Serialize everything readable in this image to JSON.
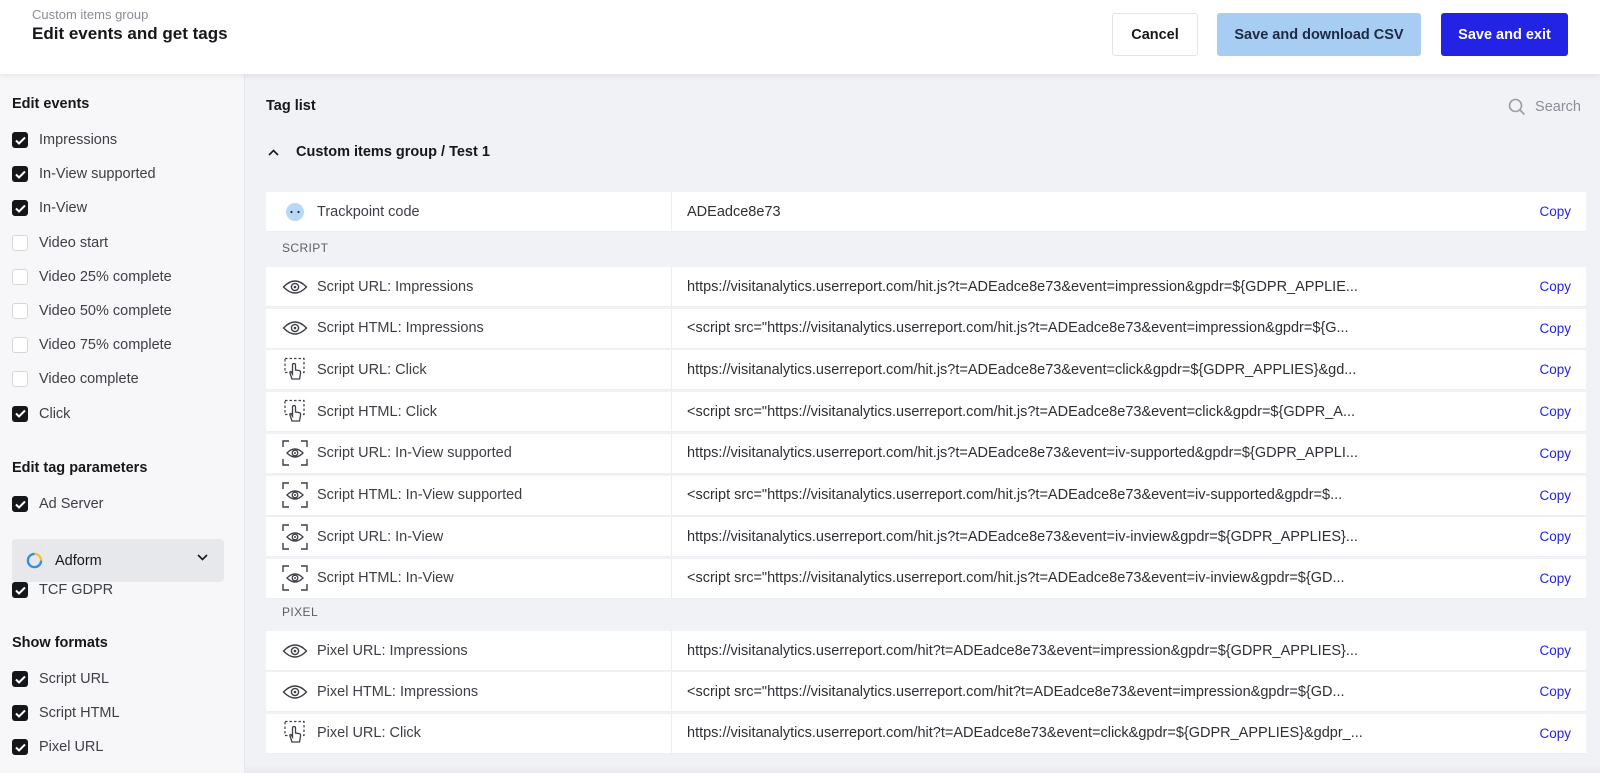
{
  "header": {
    "subtitle": "Custom items group",
    "title": "Edit events and get tags",
    "cancel_label": "Cancel",
    "csv_label": "Save and download CSV",
    "exit_label": "Save and exit"
  },
  "sidebar": {
    "edit_events_title": "Edit events",
    "events": [
      {
        "label": "Impressions",
        "checked": true
      },
      {
        "label": "In-View supported",
        "checked": true
      },
      {
        "label": "In-View",
        "checked": true
      },
      {
        "label": "Video start",
        "checked": false
      },
      {
        "label": "Video 25% complete",
        "checked": false
      },
      {
        "label": "Video 50% complete",
        "checked": false
      },
      {
        "label": "Video 75% complete",
        "checked": false
      },
      {
        "label": "Video complete",
        "checked": false
      },
      {
        "label": "Click",
        "checked": true
      }
    ],
    "tag_params_title": "Edit tag parameters",
    "ad_server_label": "Ad Server",
    "ad_server_checked": true,
    "ad_server_value": "Adform",
    "tcf_label": "TCF GDPR",
    "tcf_checked": true,
    "formats_title": "Show formats",
    "formats": [
      {
        "label": "Script URL",
        "checked": true
      },
      {
        "label": "Script HTML",
        "checked": true
      },
      {
        "label": "Pixel URL",
        "checked": true
      }
    ]
  },
  "main": {
    "tag_list_title": "Tag list",
    "search_placeholder": "Search",
    "group_title": "Custom items group / Test 1",
    "trackpoint": {
      "name": "Trackpoint code",
      "value": "ADEadce8e73",
      "copy": "Copy"
    },
    "script_label": "SCRIPT",
    "pixel_label": "PIXEL",
    "script_rows": [
      {
        "icon": "eye-icon",
        "name": "Script URL: Impressions",
        "value": "https://visitanalytics.userreport.com/hit.js?t=ADEadce8e73&event=impression&gpdr=${GDPR_APPLIE...",
        "copy": "Copy"
      },
      {
        "icon": "eye-icon",
        "name": "Script HTML: Impressions",
        "value": "<script src=\"https://visitanalytics.userreport.com/hit.js?t=ADEadce8e73&event=impression&gpdr=${G...",
        "copy": "Copy"
      },
      {
        "icon": "click-icon",
        "name": "Script URL: Click",
        "value": "https://visitanalytics.userreport.com/hit.js?t=ADEadce8e73&event=click&gpdr=${GDPR_APPLIES}&gd...",
        "copy": "Copy"
      },
      {
        "icon": "click-icon",
        "name": "Script HTML: Click",
        "value": "<script src=\"https://visitanalytics.userreport.com/hit.js?t=ADEadce8e73&event=click&gpdr=${GDPR_A...",
        "copy": "Copy"
      },
      {
        "icon": "inview-icon",
        "name": "Script URL: In-View supported",
        "value": "https://visitanalytics.userreport.com/hit.js?t=ADEadce8e73&event=iv-supported&gpdr=${GDPR_APPLI...",
        "copy": "Copy"
      },
      {
        "icon": "inview-icon",
        "name": "Script HTML: In-View supported",
        "value": "<script src=\"https://visitanalytics.userreport.com/hit.js?t=ADEadce8e73&event=iv-supported&gpdr=$...",
        "copy": "Copy"
      },
      {
        "icon": "inview-icon",
        "name": "Script URL: In-View",
        "value": "https://visitanalytics.userreport.com/hit.js?t=ADEadce8e73&event=iv-inview&gpdr=${GDPR_APPLIES}...",
        "copy": "Copy"
      },
      {
        "icon": "inview-icon",
        "name": "Script HTML: In-View",
        "value": "<script src=\"https://visitanalytics.userreport.com/hit.js?t=ADEadce8e73&event=iv-inview&gpdr=${GD...",
        "copy": "Copy"
      }
    ],
    "pixel_rows": [
      {
        "icon": "eye-icon",
        "name": "Pixel URL: Impressions",
        "value": "https://visitanalytics.userreport.com/hit?t=ADEadce8e73&event=impression&gpdr=${GDPR_APPLIES}...",
        "copy": "Copy"
      },
      {
        "icon": "eye-icon",
        "name": "Pixel HTML: Impressions",
        "value": "<script src=\"https://visitanalytics.userreport.com/hit?t=ADEadce8e73&event=impression&gpdr=${GD...",
        "copy": "Copy"
      },
      {
        "icon": "click-icon",
        "name": "Pixel URL: Click",
        "value": "https://visitanalytics.userreport.com/hit?t=ADEadce8e73&event=click&gpdr=${GDPR_APPLIES}&gdpr_...",
        "copy": "Copy"
      }
    ]
  },
  "colors": {
    "accent": "#2323e6",
    "accent_light": "#a8cdf2",
    "checkbox_on": "#15161a"
  }
}
